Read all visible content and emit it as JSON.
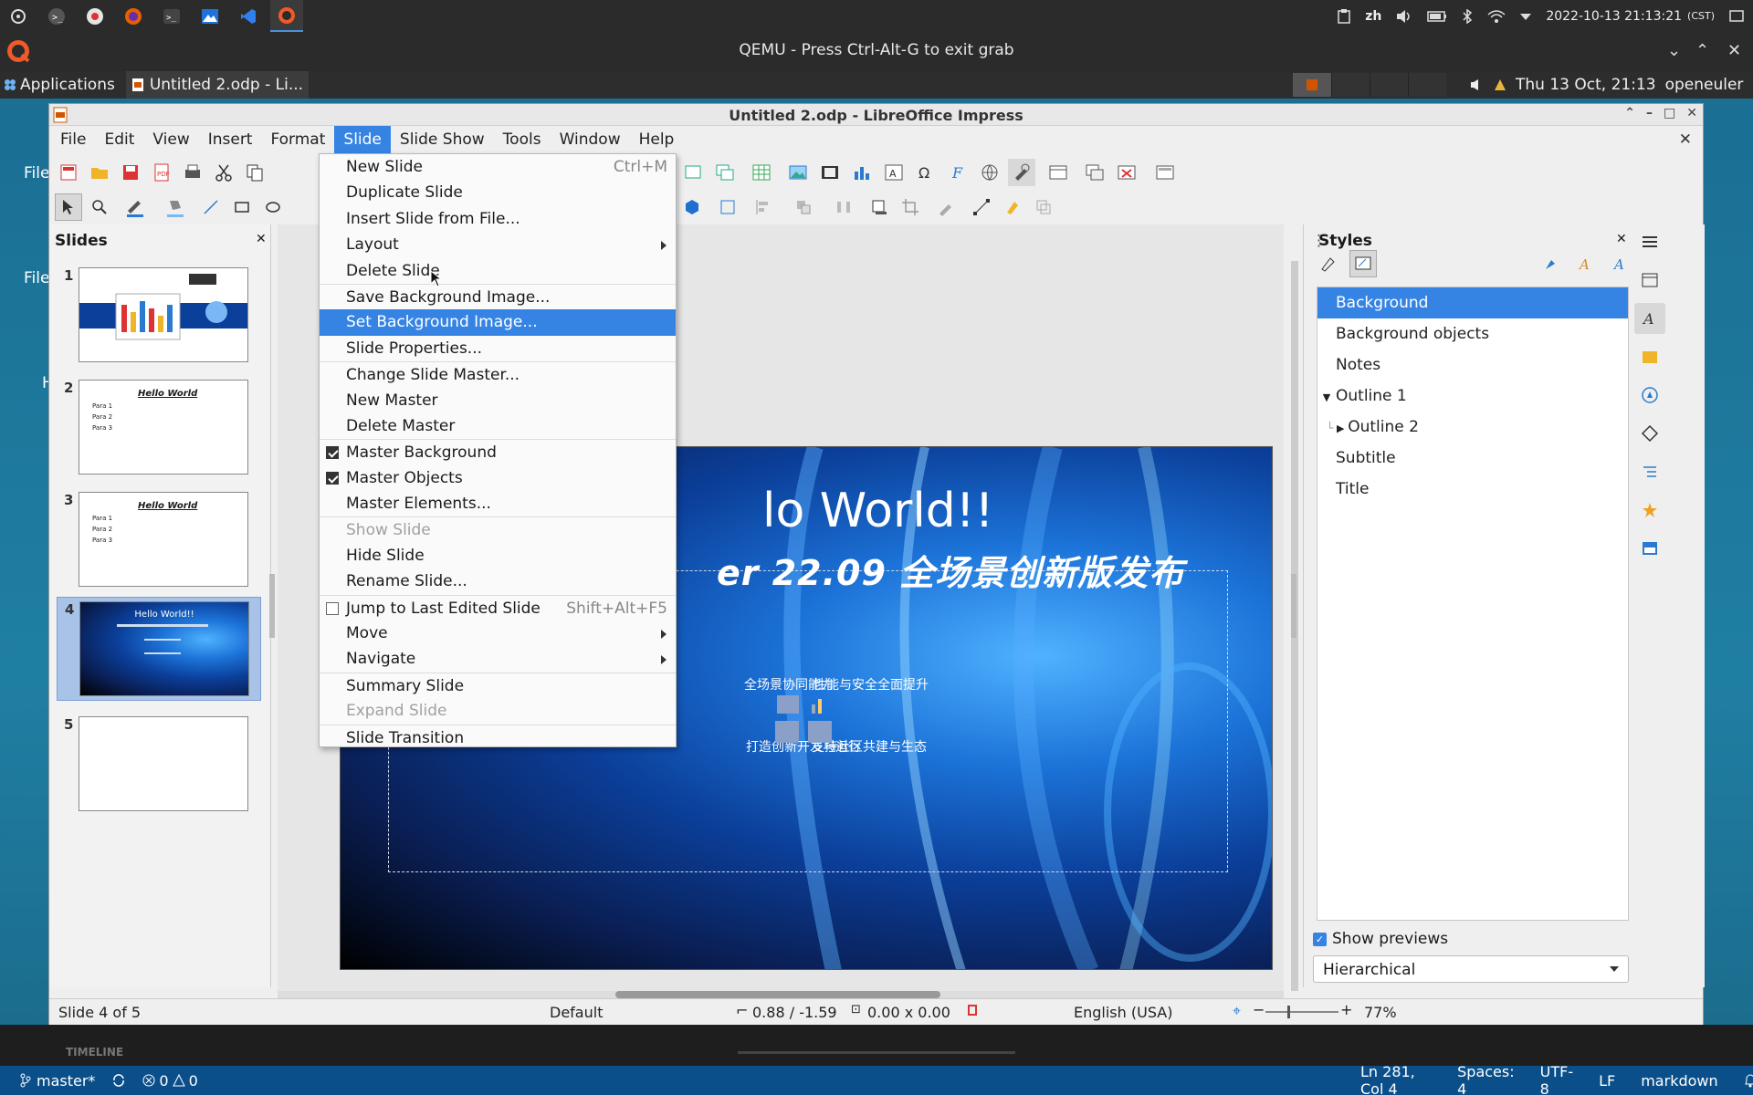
{
  "host_bar": {
    "lang": "zh",
    "datetime": "2022-10-13  21:13:21",
    "tz": "(CST)"
  },
  "qemu": {
    "title": "QEMU - Press Ctrl-Alt-G to exit grab"
  },
  "guest_panel": {
    "applications": "Applications",
    "task": "Untitled 2.odp - Li...",
    "clock": "Thu 13 Oct, 21:13",
    "user": "openeuler"
  },
  "desktop": {
    "label_a": "File",
    "label_b": "File",
    "label_c": "H"
  },
  "window": {
    "title": "Untitled 2.odp - LibreOffice Impress"
  },
  "menubar": [
    "File",
    "Edit",
    "View",
    "Insert",
    "Format",
    "Slide",
    "Slide Show",
    "Tools",
    "Window",
    "Help"
  ],
  "slides_pane": {
    "title": "Slides",
    "slides": [
      {
        "num": "1",
        "caption": ""
      },
      {
        "num": "2",
        "caption": "Hello World",
        "bullets": [
          "Para 1",
          "Para 2",
          "Para 3"
        ]
      },
      {
        "num": "3",
        "caption": "Hello World",
        "bullets": [
          "Para 1",
          "Para 2",
          "Para 3"
        ]
      },
      {
        "num": "4",
        "caption": "Hello World!!"
      },
      {
        "num": "5",
        "caption": ""
      }
    ]
  },
  "main_slide": {
    "title": "lo World!!",
    "subtitle": "er 22.09 全场景创新版发布",
    "items": [
      "全场景协同能力",
      "性能与安全全面提升",
      "打造创新开发与运行",
      "支持社区共建与生态"
    ]
  },
  "slide_menu": {
    "items": [
      {
        "label": "New Slide",
        "shortcut": "Ctrl+M"
      },
      {
        "label": "Duplicate Slide"
      },
      {
        "label": "Insert Slide from File..."
      },
      {
        "label": "Layout",
        "submenu": true
      },
      {
        "label": "Delete Slide"
      },
      {
        "label": "Save Background Image...",
        "sep": true
      },
      {
        "label": "Set Background Image...",
        "highlight": true
      },
      {
        "label": "Slide Properties..."
      },
      {
        "label": "Change Slide Master...",
        "sep": true
      },
      {
        "label": "New Master"
      },
      {
        "label": "Delete Master"
      },
      {
        "label": "Master Background",
        "sep": true,
        "check": "on"
      },
      {
        "label": "Master Objects",
        "check": "on"
      },
      {
        "label": "Master Elements..."
      },
      {
        "label": "Show Slide",
        "sep": true,
        "disabled": true
      },
      {
        "label": "Hide Slide"
      },
      {
        "label": "Rename Slide..."
      },
      {
        "label": "Jump to Last Edited Slide",
        "sep": true,
        "check": "off",
        "shortcut": "Shift+Alt+F5"
      },
      {
        "label": "Move",
        "submenu": true
      },
      {
        "label": "Navigate",
        "submenu": true
      },
      {
        "label": "Summary Slide",
        "sep": true
      },
      {
        "label": "Expand Slide",
        "disabled": true
      },
      {
        "label": "Slide Transition",
        "sep": true
      }
    ]
  },
  "styles": {
    "title": "Styles",
    "items": [
      "Background",
      "Background objects",
      "Notes",
      "Outline 1",
      "Outline 2",
      "Subtitle",
      "Title"
    ],
    "show_previews": "Show previews",
    "filter": "Hierarchical"
  },
  "statusbar": {
    "slide": "Slide 4 of 5",
    "master": "Default",
    "position": "0.88 / -1.59",
    "size": "0.00 x 0.00",
    "language": "English (USA)",
    "zoom": "77%"
  },
  "vscode": {
    "branch": "master*",
    "errors": "0",
    "warnings": "0",
    "cursor": "Ln 281, Col 4",
    "spaces": "Spaces: 4",
    "encoding": "UTF-8",
    "eol": "LF",
    "lang": "markdown",
    "timeline": "TIMELINE"
  },
  "colors": {
    "accent": "#3584e4",
    "vscode_bar": "#0b4f8a"
  }
}
